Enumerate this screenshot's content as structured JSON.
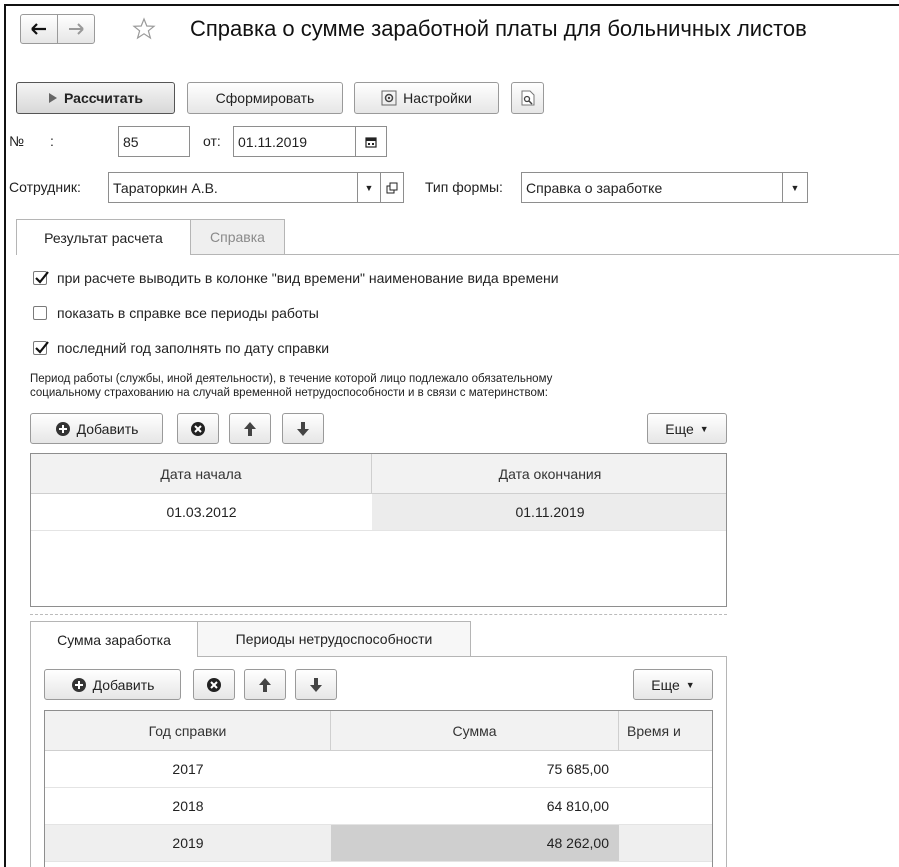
{
  "title": "Справка о сумме заработной платы для больничных листов",
  "toolbar": {
    "calculate": "Рассчитать",
    "generate": "Сформировать",
    "settings": "Настройки"
  },
  "doc": {
    "number_label": "№",
    "number_colon": ":",
    "number_value": "85",
    "from_label": "от:",
    "date_value": "01.11.2019",
    "employee_label": "Сотрудник:",
    "employee_value": "Тараторкин А.В.",
    "form_type_label": "Тип формы:",
    "form_type_value": "Справка о заработке"
  },
  "tabs": [
    {
      "label": "Результат расчета",
      "active": true
    },
    {
      "label": "Справка",
      "active": false
    }
  ],
  "checkboxes": [
    {
      "label": "при расчете выводить в колонке \"вид времени\" наименование вида времени",
      "checked": true
    },
    {
      "label": "показать в справке все периоды работы",
      "checked": false
    },
    {
      "label": "последний год заполнять по дату справки",
      "checked": true
    }
  ],
  "period_caption": {
    "line1": "Период работы (службы, иной деятельности), в течение которой лицо подлежало обязательному",
    "line2": "социальному страхованию на случай временной нетрудоспособности и в связи с материнством:"
  },
  "periods_table": {
    "add_label": "Добавить",
    "more_label": "Еще",
    "columns": [
      "Дата начала",
      "Дата окончания"
    ],
    "rows": [
      [
        "01.03.2012",
        "01.11.2019"
      ]
    ]
  },
  "bottom_tabs": [
    {
      "label": "Сумма заработка",
      "active": true
    },
    {
      "label": "Периоды нетрудоспособности",
      "active": false
    }
  ],
  "earnings_table": {
    "add_label": "Добавить",
    "more_label": "Еще",
    "columns": [
      "Год справки",
      "Сумма",
      "Время и"
    ],
    "rows": [
      [
        "2017",
        "75 685,00"
      ],
      [
        "2018",
        "64 810,00"
      ],
      [
        "2019",
        "48 262,00"
      ]
    ]
  }
}
